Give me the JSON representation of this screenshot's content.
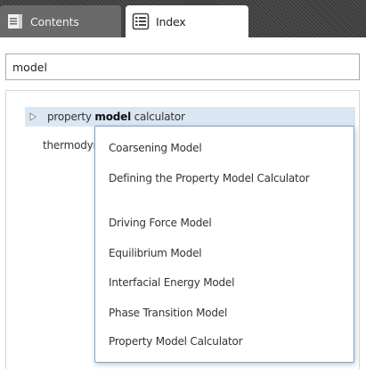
{
  "tabs": [
    {
      "label": "Contents",
      "icon": "contents-book-icon",
      "active": false
    },
    {
      "label": "Index",
      "icon": "index-list-icon",
      "active": true
    }
  ],
  "search": {
    "value": "model",
    "placeholder": ""
  },
  "results": {
    "row1": {
      "prefix": "property ",
      "match": "model",
      "suffix": " calculator",
      "expander_icon": "expand-triangle-icon"
    },
    "row2": {
      "text": "thermodynamic model"
    }
  },
  "popup": {
    "items": [
      "Coarsening Model",
      "Defining the Property Model Calculator",
      "Driving Force Model",
      "Equilibrium Model",
      "Interfacial Energy Model",
      "Phase Transition Model",
      "Property Model Calculator"
    ]
  },
  "colors": {
    "tabstrip": "#3d3d3d",
    "inactive_tab": "#6a6a6a",
    "selected_row": "#dbe6f3",
    "popup_border": "#7aa4d6"
  }
}
